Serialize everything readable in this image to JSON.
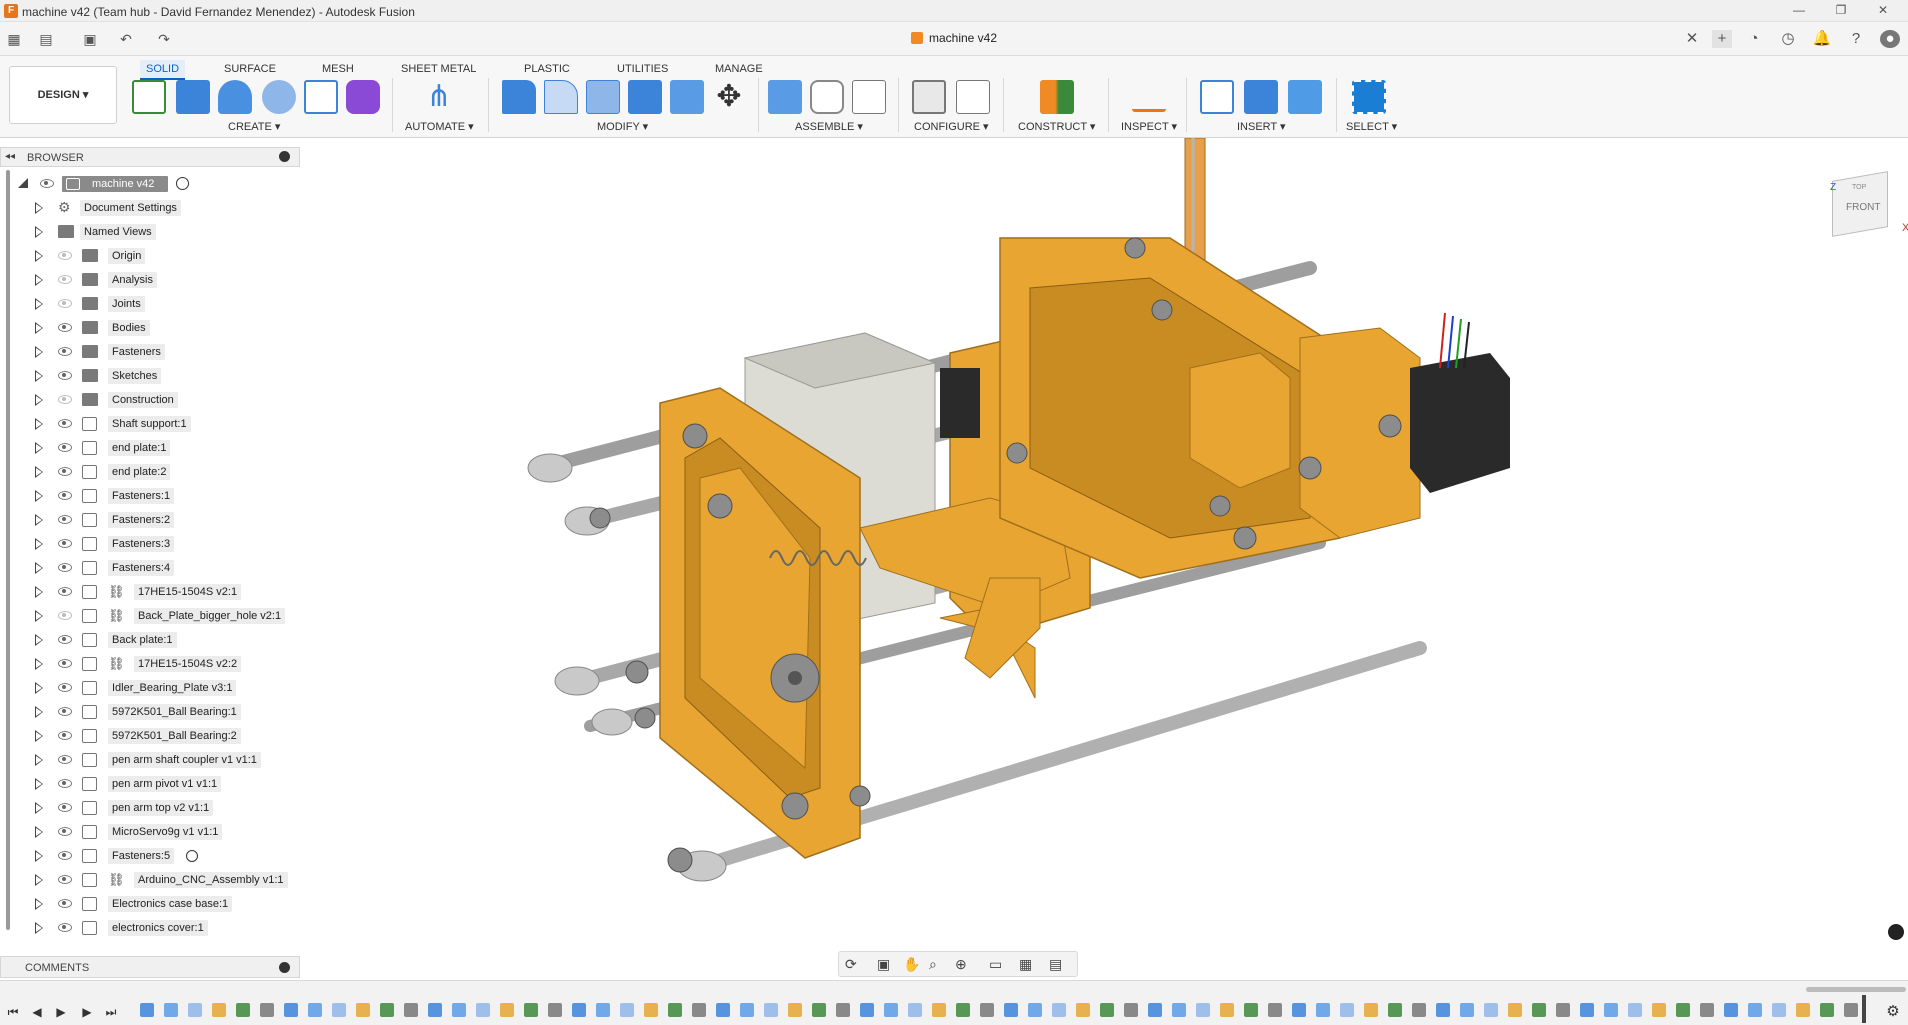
{
  "window": {
    "title": "machine v42 (Team hub - David Fernandez Menendez) - Autodesk Fusion",
    "controls": [
      "minimize",
      "restore",
      "close"
    ]
  },
  "document": {
    "name": "machine v42"
  },
  "workspace": {
    "label": "DESIGN ▾"
  },
  "tabs": [
    "SOLID",
    "SURFACE",
    "MESH",
    "SHEET METAL",
    "PLASTIC",
    "UTILITIES",
    "MANAGE"
  ],
  "active_tab": "SOLID",
  "groups": {
    "create": "CREATE ▾",
    "automate": "AUTOMATE ▾",
    "modify": "MODIFY ▾",
    "assemble": "ASSEMBLE ▾",
    "configure": "CONFIGURE ▾",
    "construct": "CONSTRUCT ▾",
    "inspect": "INSPECT ▾",
    "insert": "INSERT ▾",
    "select": "SELECT ▾"
  },
  "browser": {
    "title": "BROWSER",
    "root": "machine v42",
    "items": [
      {
        "label": "Document Settings",
        "icon": "gear-icon",
        "visible": null,
        "link": false
      },
      {
        "label": "Named Views",
        "icon": "folder-icon",
        "visible": null,
        "link": false
      },
      {
        "label": "Origin",
        "icon": "folder-icon",
        "visible": false,
        "link": false
      },
      {
        "label": "Analysis",
        "icon": "folder-icon",
        "visible": false,
        "link": false
      },
      {
        "label": "Joints",
        "icon": "folder-icon",
        "visible": false,
        "link": false
      },
      {
        "label": "Bodies",
        "icon": "folder-icon",
        "visible": true,
        "link": false
      },
      {
        "label": "Fasteners",
        "icon": "folder-icon",
        "visible": true,
        "link": false
      },
      {
        "label": "Sketches",
        "icon": "folder-icon",
        "visible": true,
        "link": false
      },
      {
        "label": "Construction",
        "icon": "folder-icon",
        "visible": false,
        "link": false
      },
      {
        "label": "Shaft support:1",
        "icon": "component-icon",
        "visible": true,
        "link": false
      },
      {
        "label": "end plate:1",
        "icon": "component-icon",
        "visible": true,
        "link": false
      },
      {
        "label": "end plate:2",
        "icon": "component-icon",
        "visible": true,
        "link": false
      },
      {
        "label": "Fasteners:1",
        "icon": "component-icon",
        "visible": true,
        "link": false
      },
      {
        "label": "Fasteners:2",
        "icon": "component-icon",
        "visible": true,
        "link": false
      },
      {
        "label": "Fasteners:3",
        "icon": "component-icon",
        "visible": true,
        "link": false
      },
      {
        "label": "Fasteners:4",
        "icon": "component-icon",
        "visible": true,
        "link": false
      },
      {
        "label": "17HE15-1504S v2:1",
        "icon": "component-icon",
        "visible": true,
        "link": true
      },
      {
        "label": "Back_Plate_bigger_hole v2:1",
        "icon": "component-icon",
        "visible": false,
        "link": true
      },
      {
        "label": "Back plate:1",
        "icon": "component-icon",
        "visible": true,
        "link": false
      },
      {
        "label": "17HE15-1504S v2:2",
        "icon": "component-icon",
        "visible": true,
        "link": true
      },
      {
        "label": "Idler_Bearing_Plate v3:1",
        "icon": "component-icon",
        "visible": true,
        "link": false
      },
      {
        "label": "5972K501_Ball Bearing:1",
        "icon": "component-icon",
        "visible": true,
        "link": false
      },
      {
        "label": "5972K501_Ball Bearing:2",
        "icon": "component-icon",
        "visible": true,
        "link": false
      },
      {
        "label": "pen arm shaft coupler v1 v1:1",
        "icon": "component-icon",
        "visible": true,
        "link": false
      },
      {
        "label": "pen arm pivot v1 v1:1",
        "icon": "component-icon",
        "visible": true,
        "link": false
      },
      {
        "label": "pen arm top v2 v1:1",
        "icon": "component-icon",
        "visible": true,
        "link": false
      },
      {
        "label": "MicroServo9g v1 v1:1",
        "icon": "component-icon",
        "visible": true,
        "link": false
      },
      {
        "label": "Fasteners:5",
        "icon": "component-icon",
        "visible": true,
        "link": false
      },
      {
        "label": "Arduino_CNC_Assembly v1:1",
        "icon": "component-icon",
        "visible": true,
        "link": true
      },
      {
        "label": "Electronics case base:1",
        "icon": "component-icon",
        "visible": true,
        "link": false
      },
      {
        "label": "electronics cover:1",
        "icon": "component-icon",
        "visible": true,
        "link": false
      }
    ]
  },
  "comments": {
    "title": "COMMENTS"
  },
  "viewcube": {
    "face": "FRONT",
    "top": "TOP",
    "axis_x": "X",
    "axis_z": "Z"
  },
  "colors": {
    "accent": "#0a62c9",
    "part_orange": "#e8a531",
    "rod": "#b8b8b8",
    "select_blue": "#1a7fd4"
  }
}
